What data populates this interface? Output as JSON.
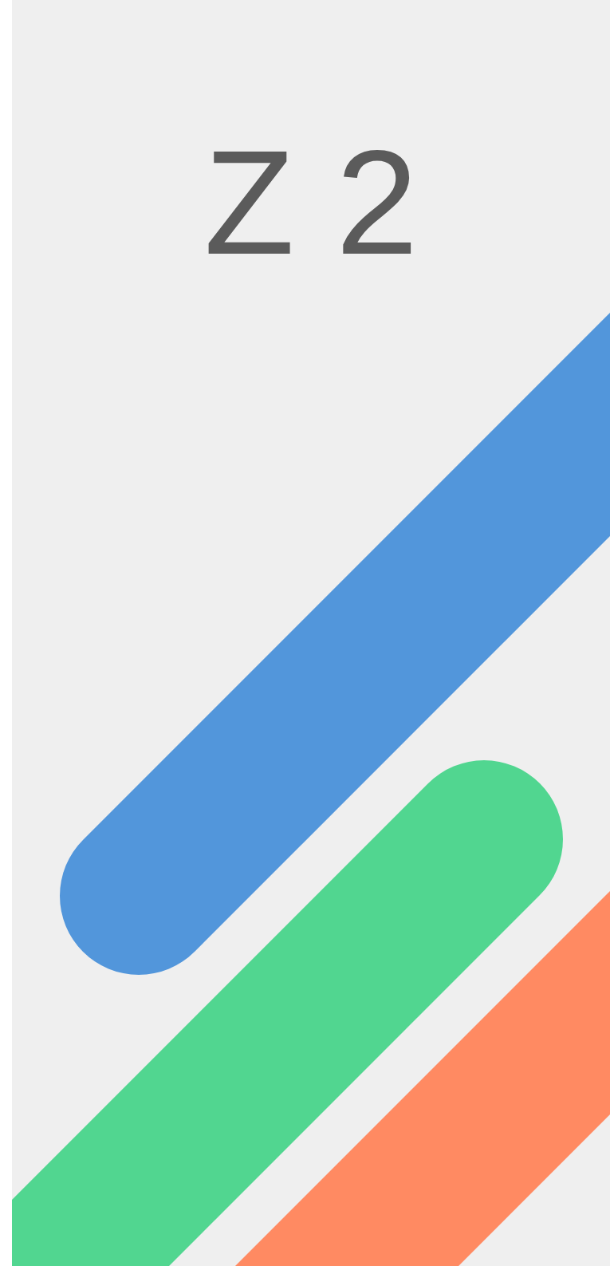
{
  "logo": {
    "text": "Z 2"
  }
}
